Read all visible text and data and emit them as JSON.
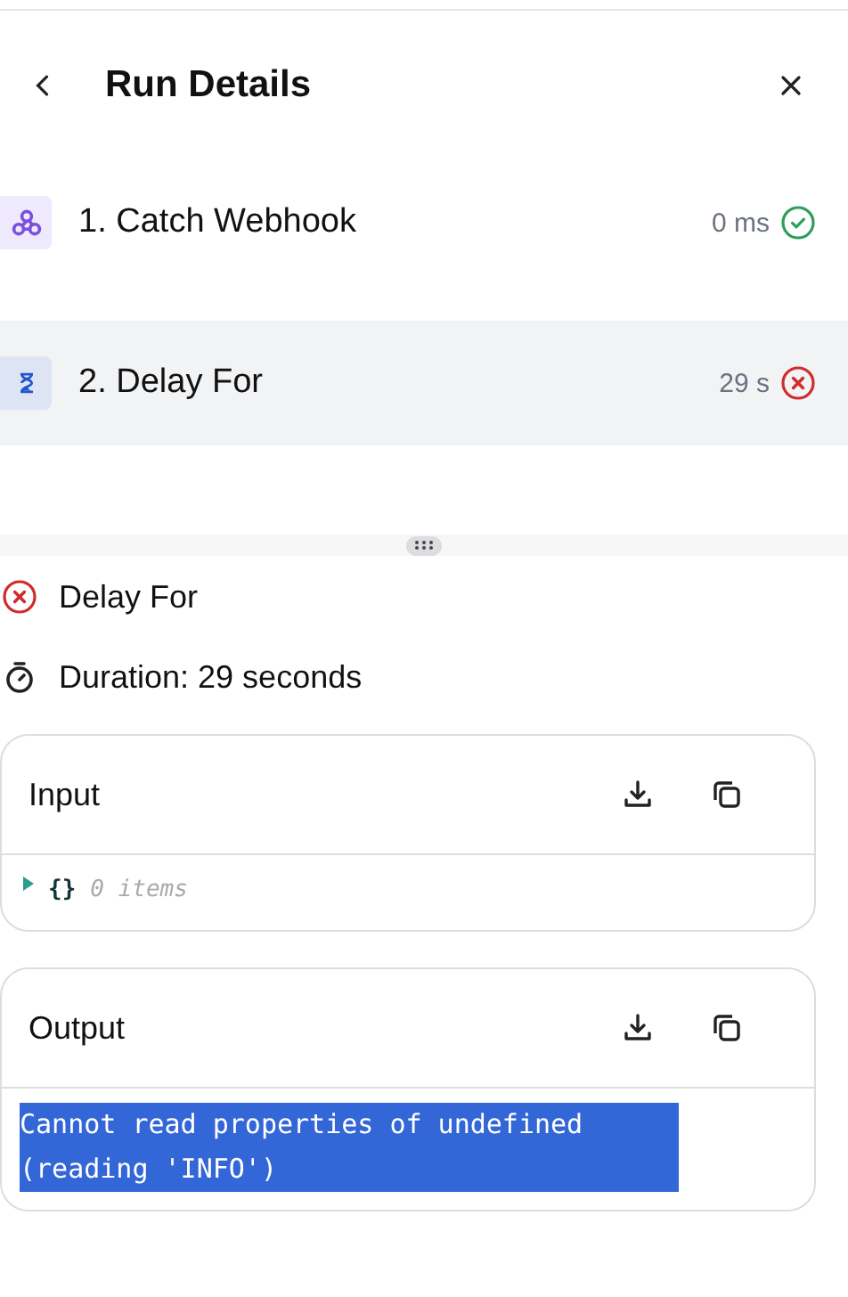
{
  "header": {
    "title": "Run Details"
  },
  "steps": [
    {
      "label": "1. Catch Webhook",
      "kind": "webhook",
      "duration": "0 ms",
      "failed": false,
      "selected": false
    },
    {
      "label": "2. Delay For",
      "kind": "delay",
      "duration": "29 s",
      "failed": true,
      "selected": true
    }
  ],
  "details": {
    "step": "Delay For",
    "failed": true,
    "duration": "Duration: 29 seconds"
  },
  "input": {
    "title": "Input",
    "expanded": false,
    "braces": "{}",
    "count": "0 items"
  },
  "output": {
    "title": "Output",
    "text": "Cannot read properties of undefined (reading 'INFO')",
    "selected": true
  }
}
